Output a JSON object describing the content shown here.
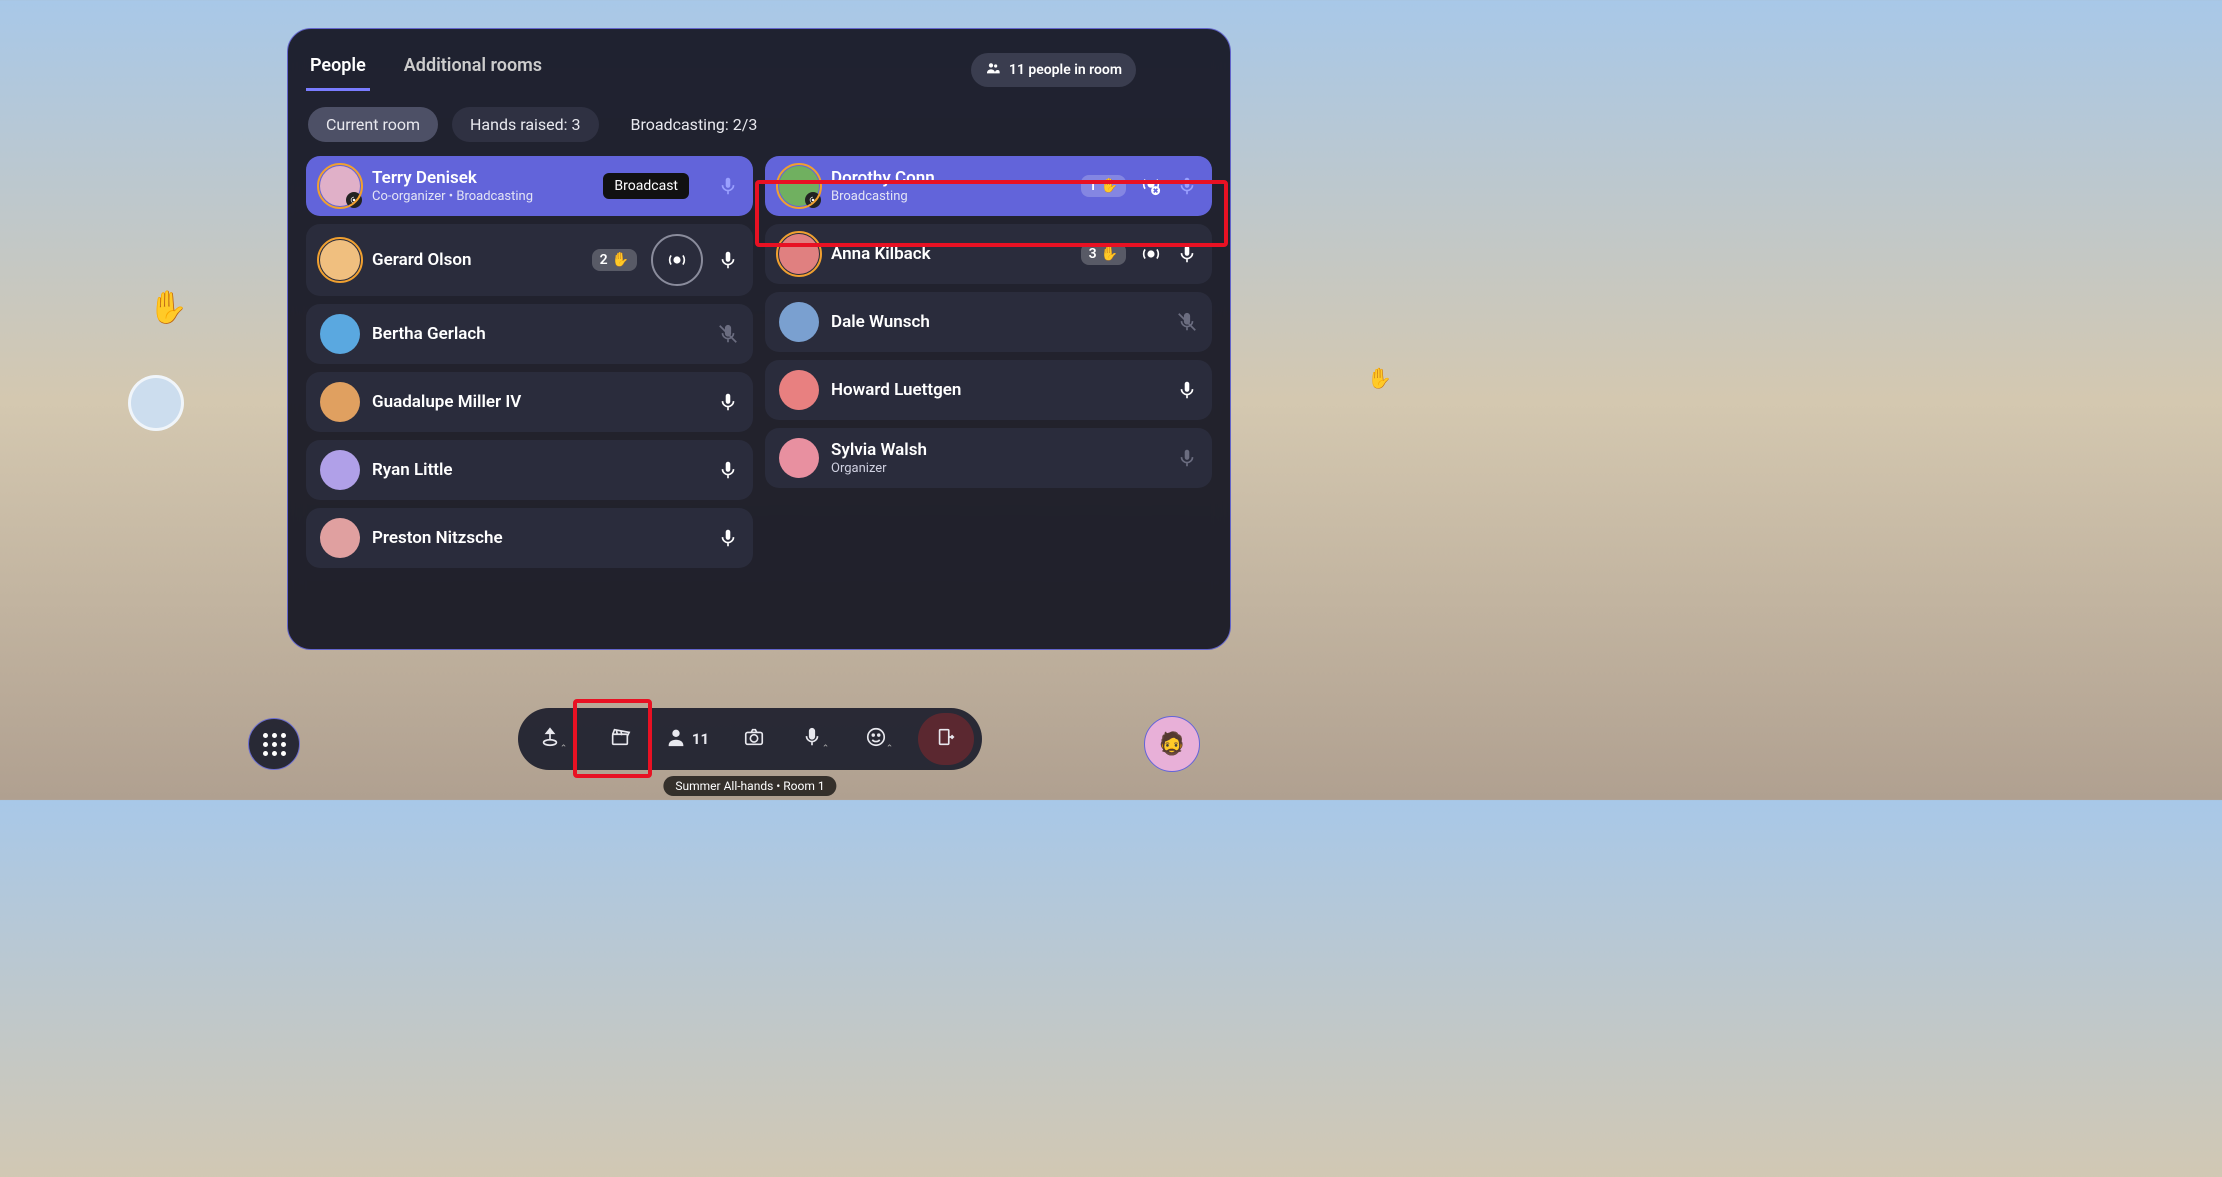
{
  "tabs": {
    "people": "People",
    "rooms": "Additional rooms"
  },
  "room_count": {
    "label": "11 people in room"
  },
  "filters": {
    "current_room": "Current room",
    "hands_raised": "Hands raised: 3",
    "broadcasting": "Broadcasting: 2/3"
  },
  "tooltip_broadcast": "Broadcast",
  "people_left": [
    {
      "name": "Terry Denisek",
      "sub": "Co-organizer • Broadcasting",
      "avatar_color": "#e0b0c8",
      "ring": true,
      "hl": true,
      "mic": "faint",
      "badge": true
    },
    {
      "name": "Gerard Olson",
      "sub": "",
      "avatar_color": "#f0bf7f",
      "ring": true,
      "hand": "2",
      "broadcast_ring": true,
      "mic": "on"
    },
    {
      "name": "Bertha Gerlach",
      "sub": "",
      "avatar_color": "#5aa8e0",
      "mic": "muted"
    },
    {
      "name": "Guadalupe Miller IV",
      "sub": "",
      "avatar_color": "#e0a060",
      "mic": "on"
    },
    {
      "name": "Ryan Little",
      "sub": "",
      "avatar_color": "#b0a0e8",
      "mic": "on"
    },
    {
      "name": "Preston Nitzsche",
      "sub": "",
      "avatar_color": "#e0a0a0",
      "mic": "on"
    }
  ],
  "people_right": [
    {
      "name": "Dorothy Conn",
      "sub": "Broadcasting",
      "avatar_color": "#70b060",
      "ring": true,
      "hl": true,
      "hand": "1",
      "broadcast_x": true,
      "mic": "faint",
      "badge": true
    },
    {
      "name": "Anna Kilback",
      "sub": "",
      "avatar_color": "#e08080",
      "ring": true,
      "hand": "3",
      "broadcast": true,
      "mic": "on"
    },
    {
      "name": "Dale Wunsch",
      "sub": "",
      "avatar_color": "#7aa0d0",
      "mic": "muted"
    },
    {
      "name": "Howard Luettgen",
      "sub": "",
      "avatar_color": "#e88080",
      "mic": "on"
    },
    {
      "name": "Sylvia Walsh",
      "sub": "Organizer",
      "avatar_color": "#e890a0",
      "mic": "vmuted"
    }
  ],
  "bottom": {
    "people_count": "11"
  },
  "session": "Summer All-hands • Room 1"
}
